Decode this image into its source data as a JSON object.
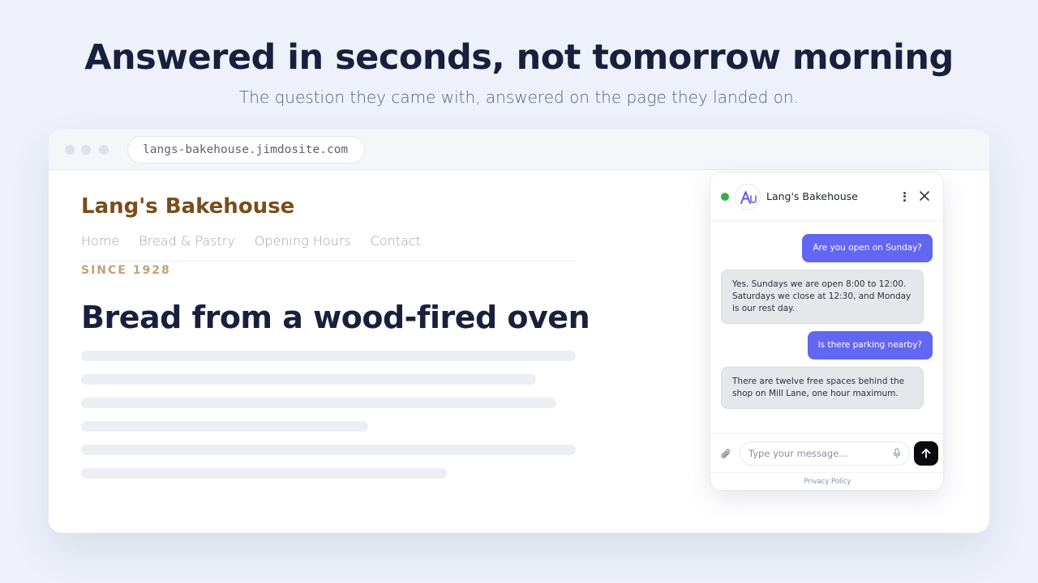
{
  "hero": {
    "headline": "Answered in seconds, not tomorrow morning",
    "subhead": "The question they came with, answered on the page they landed on."
  },
  "browser": {
    "url": "langs-bakehouse.jimdosite.com"
  },
  "site": {
    "brand": "Lang's Bakehouse",
    "nav": [
      "Home",
      "Bread & Pastry",
      "Opening Hours",
      "Contact"
    ],
    "eyebrow": "SINCE 1928",
    "title": "Bread from a wood-fired oven",
    "colors": {
      "brand": "#7a4d1b",
      "eyebrow": "#c2a275",
      "title": "#1a1f3d"
    }
  },
  "chat": {
    "title": "Lang's Bakehouse",
    "status": "online",
    "messages": [
      {
        "from": "user",
        "text": "Are you open on Sunday?"
      },
      {
        "from": "bot",
        "text": "Yes. Sundays we are open 8:00 to 12:00. Saturdays we close at 12:30, and Monday is our rest day."
      },
      {
        "from": "user",
        "text": "Is there parking nearby?"
      },
      {
        "from": "bot",
        "text": "There are twelve free spaces behind the shop on Mill Lane, one hour maximum."
      }
    ],
    "input_placeholder": "Type your message...",
    "input_value": "",
    "privacy_label": "Privacy Policy",
    "colors": {
      "user_bubble": "#6366f1",
      "bot_bubble": "#e5e7eb",
      "status": "#34b04a",
      "send": "#0b0b0f"
    },
    "icons": [
      "logo-icon",
      "kebab-menu-icon",
      "close-icon",
      "paperclip-icon",
      "microphone-icon",
      "send-arrow-icon"
    ]
  }
}
